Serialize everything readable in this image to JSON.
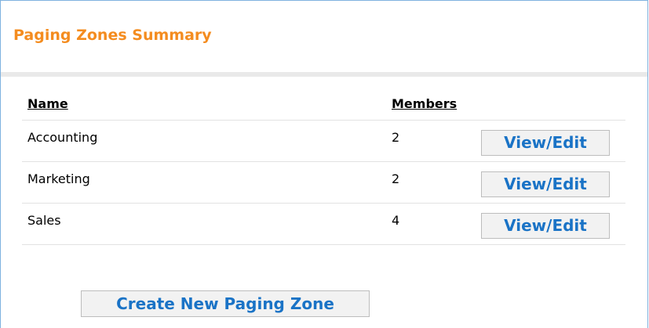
{
  "panel": {
    "title": "Paging Zones Summary"
  },
  "table": {
    "headers": {
      "name": "Name",
      "members": "Members"
    },
    "rows": [
      {
        "name": "Accounting",
        "members": "2",
        "action": "View/Edit"
      },
      {
        "name": "Marketing",
        "members": "2",
        "action": "View/Edit"
      },
      {
        "name": "Sales",
        "members": "4",
        "action": "View/Edit"
      }
    ]
  },
  "actions": {
    "create_label": "Create New Paging Zone"
  },
  "colors": {
    "title": "#f48c1f",
    "button_text": "#1a73c6",
    "panel_border": "#7fb2df"
  }
}
